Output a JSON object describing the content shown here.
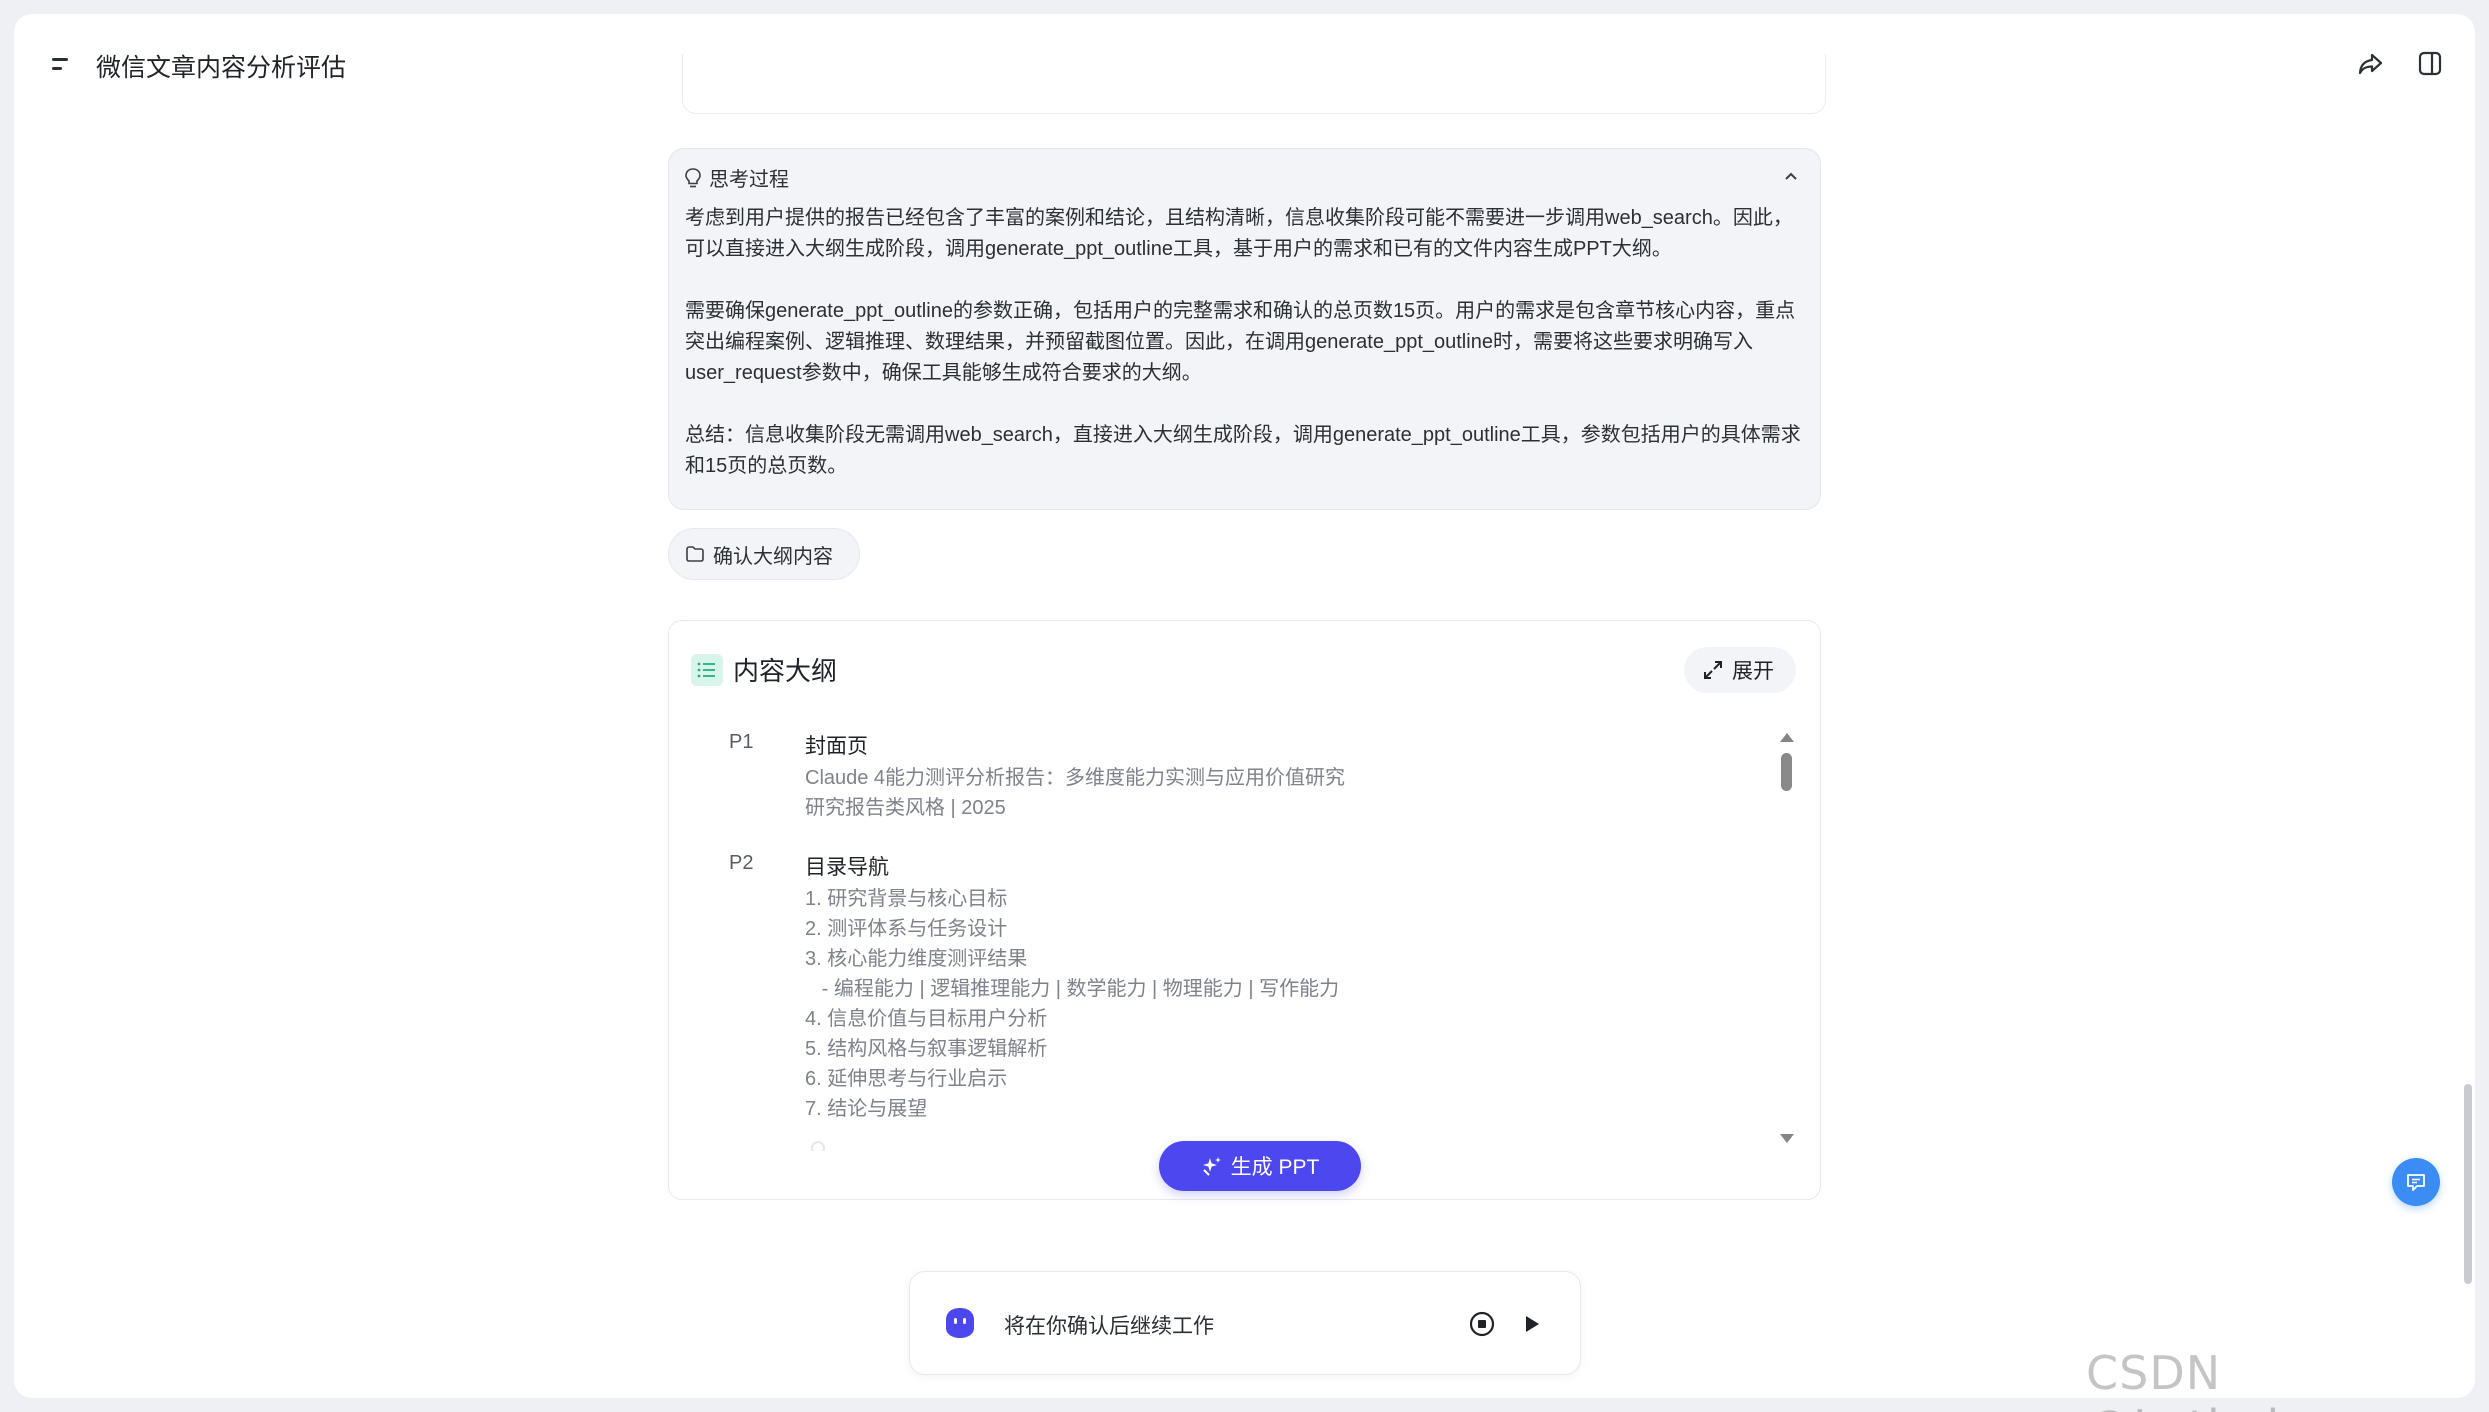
{
  "header": {
    "title": "微信文章内容分析评估"
  },
  "thinking": {
    "label": "思考过程",
    "paragraphs": [
      "考虑到用户提供的报告已经包含了丰富的案例和结论，且结构清晰，信息收集阶段可能不需要进一步调用web_search。因此，可以直接进入大纲生成阶段，调用generate_ppt_outline工具，基于用户的需求和已有的文件内容生成PPT大纲。",
      "需要确保generate_ppt_outline的参数正确，包括用户的完整需求和确认的总页数15页。用户的需求是包含章节核心内容，重点突出编程案例、逻辑推理、数理结果，并预留截图位置。因此，在调用generate_ppt_outline时，需要将这些要求明确写入user_request参数中，确保工具能够生成符合要求的大纲。",
      "总结：信息收集阶段无需调用web_search，直接进入大纲生成阶段，调用generate_ppt_outline工具，参数包括用户的具体需求和15页的总页数。"
    ]
  },
  "confirm_chip": {
    "label": "确认大纲内容"
  },
  "outline": {
    "title": "内容大纲",
    "expand_label": "展开",
    "pages": [
      {
        "num": "P1",
        "title": "封面页",
        "lines": [
          "Claude 4能力测评分析报告：多维度能力实测与应用价值研究",
          "研究报告类风格 | 2025"
        ]
      },
      {
        "num": "P2",
        "title": "目录导航",
        "lines": [
          "1. 研究背景与核心目标",
          "2. 测评体系与任务设计",
          "3. 核心能力维度测评结果",
          "   - 编程能力 | 逻辑推理能力 | 数学能力 | 物理能力 | 写作能力",
          "4. 信息价值与目标用户分析",
          "5. 结构风格与叙事逻辑解析",
          "6. 延伸思考与行业启示",
          "7. 结论与展望"
        ]
      }
    ],
    "generate_label": "生成 PPT"
  },
  "input_bar": {
    "text": "将在你确认后继续工作"
  },
  "watermark": "CSDN @Lethehong",
  "colors": {
    "accent": "#4c47ee",
    "float_button": "#3b8cf5",
    "outline_icon_bg": "#d7f5ea"
  }
}
